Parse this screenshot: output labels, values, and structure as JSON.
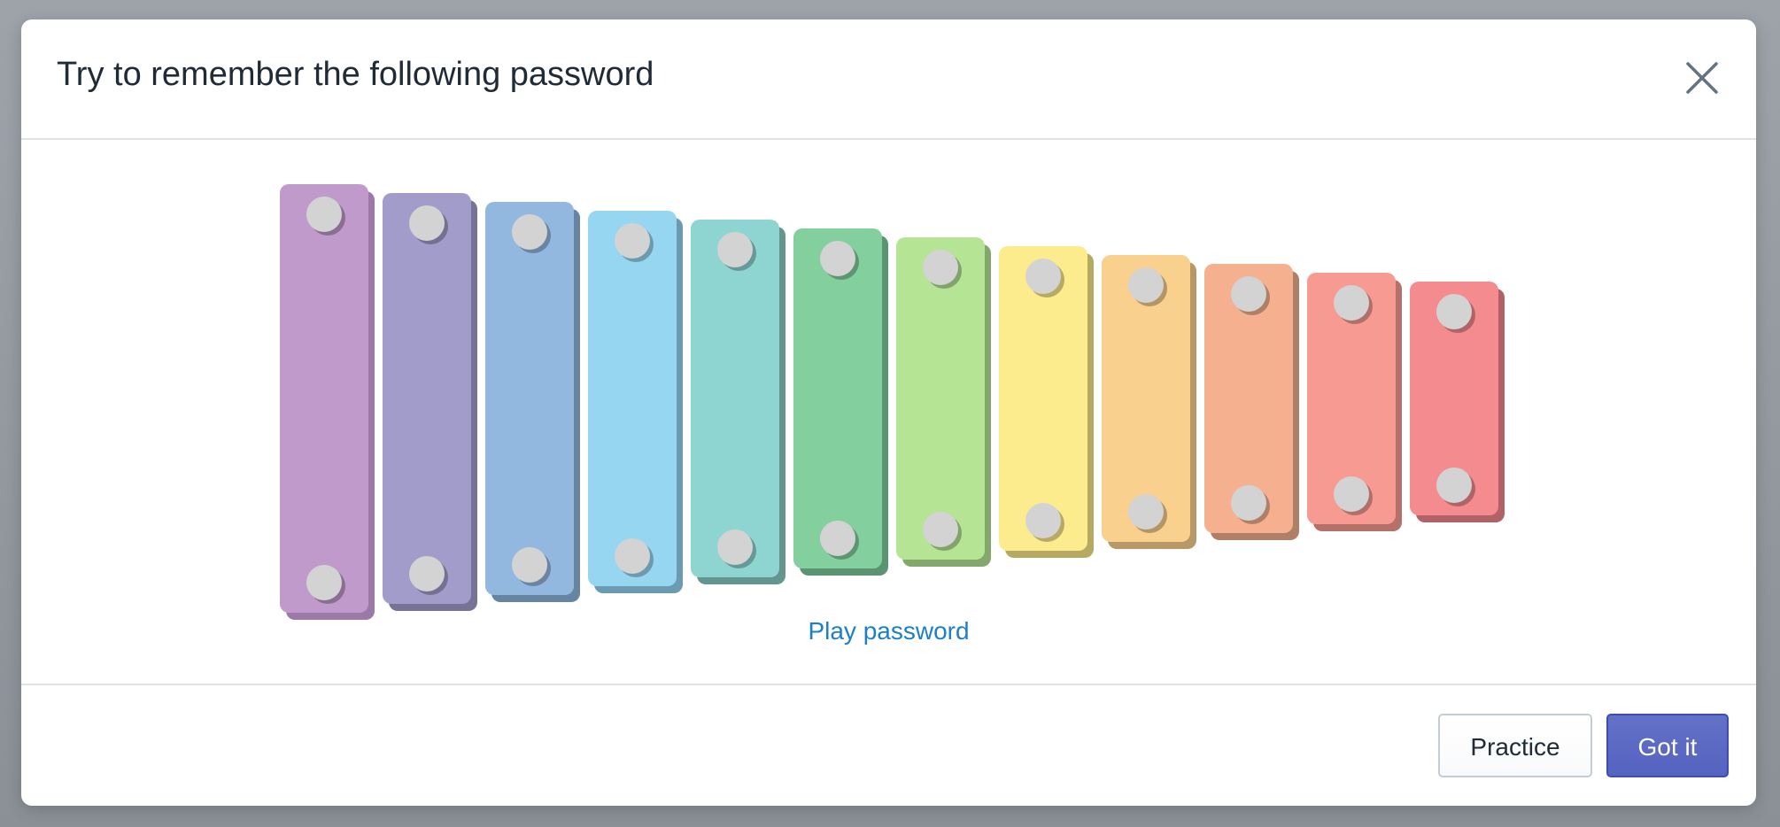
{
  "dialog": {
    "title": "Try to remember the following password",
    "close_icon": "close-icon"
  },
  "xylophone": {
    "bars": [
      {
        "note": 1,
        "color": "#bf9acb",
        "shadow": "#9b7aa7"
      },
      {
        "note": 2,
        "color": "#a19cc9",
        "shadow": "#777396"
      },
      {
        "note": 3,
        "color": "#93b8e0",
        "shadow": "#6784a3"
      },
      {
        "note": 4,
        "color": "#97d6f0",
        "shadow": "#6b9bb0"
      },
      {
        "note": 5,
        "color": "#8ed5d1",
        "shadow": "#64958f"
      },
      {
        "note": 6,
        "color": "#83d09e",
        "shadow": "#5a9471"
      },
      {
        "note": 7,
        "color": "#b4e494",
        "shadow": "#84a86b"
      },
      {
        "note": 8,
        "color": "#fdec8d",
        "shadow": "#b6aa63"
      },
      {
        "note": 9,
        "color": "#f9d08e",
        "shadow": "#b79866"
      },
      {
        "note": 10,
        "color": "#f4b08f",
        "shadow": "#b07f67"
      },
      {
        "note": 11,
        "color": "#f69a92",
        "shadow": "#b5706a"
      },
      {
        "note": 12,
        "color": "#f48b8f",
        "shadow": "#b06266"
      }
    ],
    "play_label": "Play password"
  },
  "footer": {
    "practice_label": "Practice",
    "confirm_label": "Got it"
  },
  "colors": {
    "link": "#1c7fc7",
    "primary": "#5c6ac4"
  }
}
